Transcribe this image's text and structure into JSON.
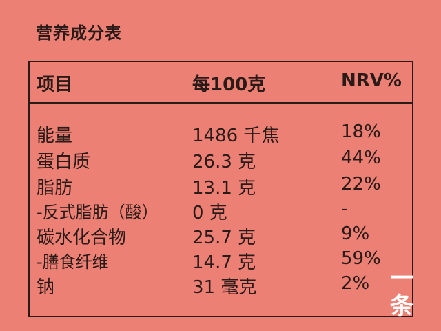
{
  "title": "营养成分表",
  "header": {
    "item": "项目",
    "per": "每100克",
    "nrv": "NRV%"
  },
  "rows": [
    {
      "name": "能量",
      "value": "1486 千焦",
      "nrv": "18%"
    },
    {
      "name": "蛋白质",
      "value": "26.3 克",
      "nrv": "44%"
    },
    {
      "name": "脂肪",
      "value": "13.1 克",
      "nrv": "22%"
    },
    {
      "name": "-反式脂肪（酸）",
      "value": "0 克",
      "nrv": "-"
    },
    {
      "name": "碳水化合物",
      "value": "25.7 克",
      "nrv": "9%"
    },
    {
      "name": "-膳食纤维",
      "value": "14.7 克",
      "nrv": "59%"
    },
    {
      "name": "钠",
      "value": "31 毫克",
      "nrv": "2%"
    }
  ],
  "watermark": {
    "top": "一",
    "bottom": "条"
  }
}
